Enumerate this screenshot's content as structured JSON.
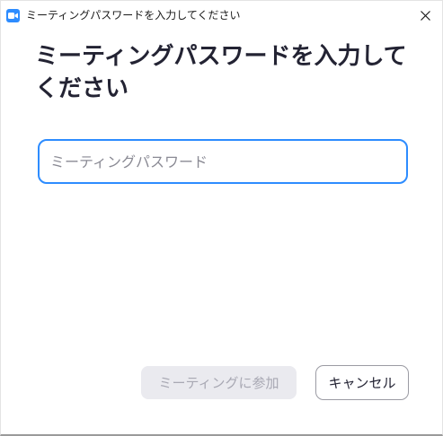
{
  "window": {
    "title": "ミーティングパスワードを入力してください",
    "app_icon": "zoom-video-camera-icon",
    "close_icon": "close-icon"
  },
  "main": {
    "heading": "ミーティングパスワードを入力してください",
    "password_input": {
      "value": "",
      "placeholder": "ミーティングパスワード"
    }
  },
  "actions": {
    "join_label": "ミーティングに参加",
    "cancel_label": "キャンセル"
  },
  "colors": {
    "accent": "#2d8cff",
    "disabled_bg": "#eaeaef",
    "disabled_text": "#a8a8b3",
    "text": "#232333"
  }
}
